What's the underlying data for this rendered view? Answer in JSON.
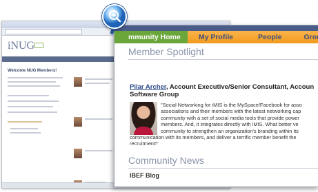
{
  "background_page": {
    "logo_text": "iNUG",
    "welcome_text": "Welcome NUG Members!"
  },
  "zoom_panel": {
    "nav_tabs": [
      {
        "label": "mmunity Home",
        "active": true
      },
      {
        "label": "My Profile",
        "active": false
      },
      {
        "label": "People",
        "active": false
      },
      {
        "label": "Groups",
        "active": false
      }
    ],
    "spotlight": {
      "title": "Member Spotlight",
      "member_name": "Pilar Archer",
      "member_role": ", Account Executive/Senior Consultant, Accoun",
      "member_org": "Software Group",
      "quote_part1": "\"Social Networking for iMIS is the MySpace/Facebook for asso associations and their members with the latest networking cap community with a set of social media tools that provide power members. And, it integrates directly with iMIS. What better ve community to strengthen an organization's branding within its",
      "quote_part2": "communication with its members, and deliver a terrific member benefit the recruitment!\""
    },
    "news": {
      "title": "Community News",
      "blog_title": "IBEF Blog"
    }
  },
  "colors": {
    "nav_orange": "#f29a1e",
    "nav_active_green": "#6aa63a",
    "nav_text": "#3d4f7d",
    "section_title": "#8a94a8",
    "link_blue": "#2a4a8a",
    "magnifier_blue": "#1f63b8"
  },
  "icons": {
    "magnifier": "zoom-in-icon"
  }
}
